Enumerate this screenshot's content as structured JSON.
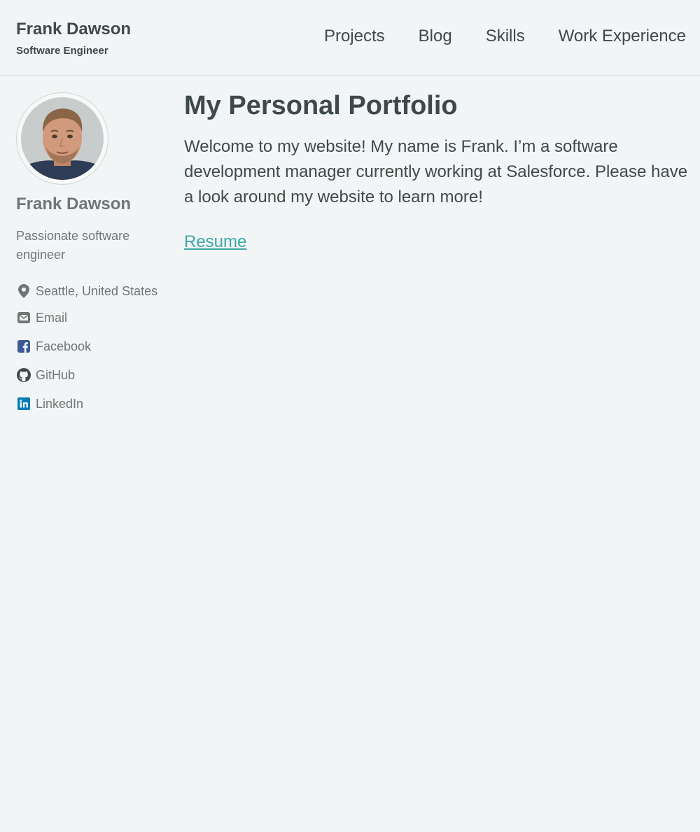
{
  "header": {
    "site_title": "Frank Dawson",
    "site_subtitle": "Software Engineer",
    "nav": [
      "Projects",
      "Blog",
      "Skills",
      "Work Experience"
    ]
  },
  "sidebar": {
    "name": "Frank Dawson",
    "bio": "Passionate software engineer",
    "location": "Seattle, United States",
    "links": [
      {
        "label": "Email",
        "icon": "envelope-icon"
      },
      {
        "label": "Facebook",
        "icon": "facebook-icon"
      },
      {
        "label": "GitHub",
        "icon": "github-icon"
      },
      {
        "label": "LinkedIn",
        "icon": "linkedin-icon"
      }
    ]
  },
  "main": {
    "title": "My Personal Portfolio",
    "intro": "Welcome to my website! My name is Frank. I’m a software development manager currently working at Salesforce. Please have a look around my website to learn more!",
    "resume_link": "Resume"
  },
  "colors": {
    "background": "#f2f5f6",
    "text": "#3f4a48",
    "muted_text": "#6e7775",
    "link": "#3fa8a5",
    "facebook": "#3b5998",
    "linkedin": "#007bb6"
  }
}
